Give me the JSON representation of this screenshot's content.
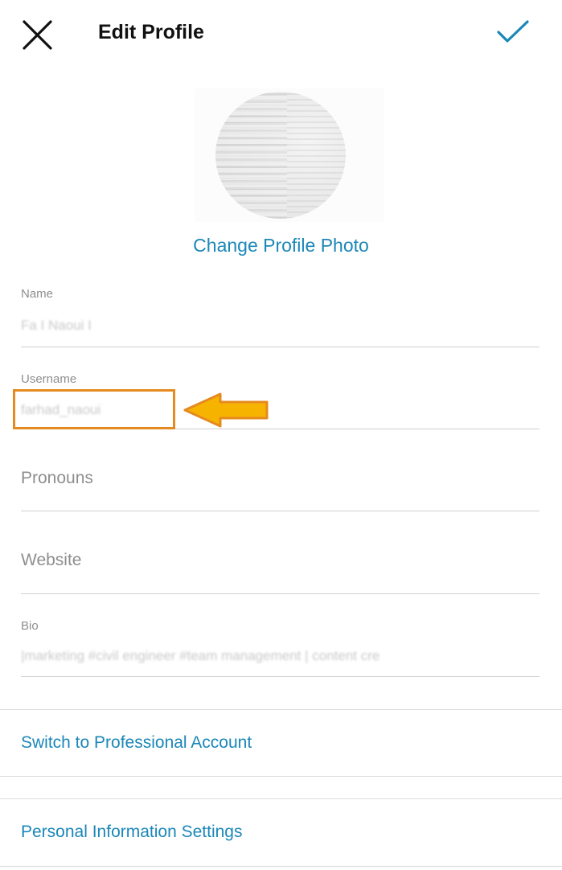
{
  "header": {
    "title": "Edit Profile",
    "close_icon": "close-icon",
    "confirm_icon": "checkmark-icon"
  },
  "profile_photo": {
    "change_label": "Change Profile Photo"
  },
  "fields": {
    "name": {
      "label": "Name",
      "value": "Fa    I Naoui I"
    },
    "username": {
      "label": "Username",
      "value": "farhad_naoui"
    },
    "pronouns": {
      "placeholder": "Pronouns"
    },
    "website": {
      "placeholder": "Website"
    },
    "bio": {
      "label": "Bio",
      "value": "|marketing #civil engineer #team management | content cre"
    }
  },
  "links": {
    "professional": "Switch to Professional Account",
    "personal_info": "Personal Information Settings"
  },
  "colors": {
    "accent": "#1b87b8",
    "highlight": "#e58a1f",
    "arrow": "#f6b400"
  }
}
